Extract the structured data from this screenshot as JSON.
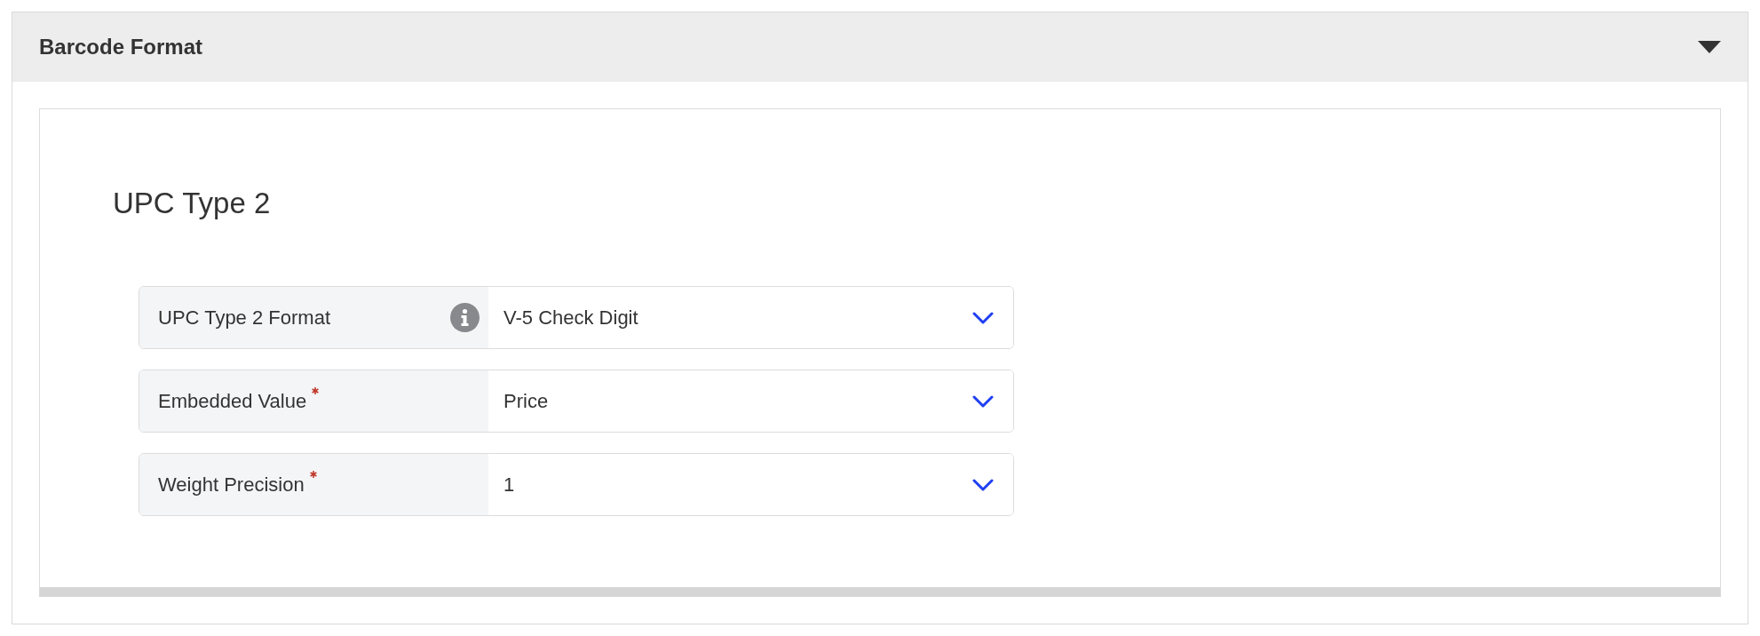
{
  "panel": {
    "title": "Barcode Format",
    "expanded": true
  },
  "section": {
    "heading": "UPC Type 2"
  },
  "fields": [
    {
      "label": "UPC Type 2 Format",
      "required": false,
      "info": true,
      "value": "V-5 Check Digit"
    },
    {
      "label": "Embedded Value",
      "required": true,
      "info": false,
      "value": "Price"
    },
    {
      "label": "Weight Precision",
      "required": true,
      "info": false,
      "value": "1"
    }
  ]
}
